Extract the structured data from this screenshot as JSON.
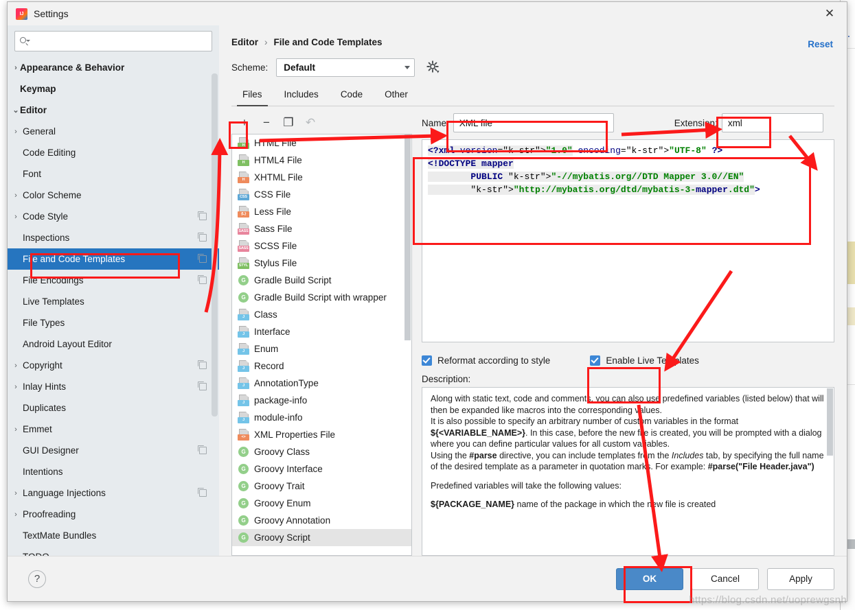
{
  "window": {
    "title": "Settings",
    "logo_icon": "intellij-idea-logo",
    "close_icon": "close-icon"
  },
  "sidebar": {
    "search": {
      "placeholder": "",
      "value": "",
      "icon": "search-icon"
    },
    "items": [
      {
        "label": "Appearance & Behavior",
        "level": 0,
        "chevron": "›",
        "bold": true,
        "badge": false
      },
      {
        "label": "Keymap",
        "level": 0,
        "chevron": "",
        "bold": true,
        "badge": false
      },
      {
        "label": "Editor",
        "level": 0,
        "chevron": "⌄",
        "bold": true,
        "badge": false
      },
      {
        "label": "General",
        "level": 1,
        "chevron": "›",
        "bold": false,
        "badge": false
      },
      {
        "label": "Code Editing",
        "level": 1,
        "chevron": "",
        "bold": false,
        "badge": false
      },
      {
        "label": "Font",
        "level": 1,
        "chevron": "",
        "bold": false,
        "badge": false
      },
      {
        "label": "Color Scheme",
        "level": 1,
        "chevron": "›",
        "bold": false,
        "badge": false
      },
      {
        "label": "Code Style",
        "level": 1,
        "chevron": "›",
        "bold": false,
        "badge": true
      },
      {
        "label": "Inspections",
        "level": 1,
        "chevron": "",
        "bold": false,
        "badge": true
      },
      {
        "label": "File and Code Templates",
        "level": 1,
        "chevron": "",
        "bold": false,
        "badge": true,
        "selected": true
      },
      {
        "label": "File Encodings",
        "level": 1,
        "chevron": "",
        "bold": false,
        "badge": true
      },
      {
        "label": "Live Templates",
        "level": 1,
        "chevron": "",
        "bold": false,
        "badge": false
      },
      {
        "label": "File Types",
        "level": 1,
        "chevron": "",
        "bold": false,
        "badge": false
      },
      {
        "label": "Android Layout Editor",
        "level": 1,
        "chevron": "",
        "bold": false,
        "badge": false
      },
      {
        "label": "Copyright",
        "level": 1,
        "chevron": "›",
        "bold": false,
        "badge": true
      },
      {
        "label": "Inlay Hints",
        "level": 1,
        "chevron": "›",
        "bold": false,
        "badge": true
      },
      {
        "label": "Duplicates",
        "level": 1,
        "chevron": "",
        "bold": false,
        "badge": false
      },
      {
        "label": "Emmet",
        "level": 1,
        "chevron": "›",
        "bold": false,
        "badge": false
      },
      {
        "label": "GUI Designer",
        "level": 1,
        "chevron": "",
        "bold": false,
        "badge": true
      },
      {
        "label": "Intentions",
        "level": 1,
        "chevron": "",
        "bold": false,
        "badge": false
      },
      {
        "label": "Language Injections",
        "level": 1,
        "chevron": "›",
        "bold": false,
        "badge": true
      },
      {
        "label": "Proofreading",
        "level": 1,
        "chevron": "›",
        "bold": false,
        "badge": false
      },
      {
        "label": "TextMate Bundles",
        "level": 1,
        "chevron": "",
        "bold": false,
        "badge": false
      },
      {
        "label": "TODO",
        "level": 1,
        "chevron": "",
        "bold": false,
        "badge": false
      }
    ]
  },
  "main": {
    "breadcrumb": {
      "parent": "Editor",
      "separator": "›",
      "current": "File and Code Templates"
    },
    "reset_label": "Reset",
    "scheme": {
      "label": "Scheme:",
      "value": "Default",
      "gear_icon": "gear-icon"
    },
    "tabs": [
      {
        "label": "Files",
        "active": true
      },
      {
        "label": "Includes",
        "active": false
      },
      {
        "label": "Code",
        "active": false
      },
      {
        "label": "Other",
        "active": false
      }
    ],
    "toolbar": [
      {
        "icon": "plus-icon",
        "glyph": "+",
        "dim": false
      },
      {
        "icon": "minus-icon",
        "glyph": "−",
        "dim": false
      },
      {
        "icon": "copy-icon",
        "glyph": "❐",
        "dim": false
      },
      {
        "icon": "undo-icon",
        "glyph": "↶",
        "dim": true
      }
    ],
    "template_list": [
      {
        "label": "HTML File",
        "icon": "html-file-icon",
        "badge": "H",
        "color": "#7fbf62",
        "shape": "page"
      },
      {
        "label": "HTML4 File",
        "icon": "html4-file-icon",
        "badge": "H",
        "color": "#7fbf62",
        "shape": "page"
      },
      {
        "label": "XHTML File",
        "icon": "xhtml-file-icon",
        "badge": "H",
        "color": "#ef8b5c",
        "shape": "page"
      },
      {
        "label": "CSS File",
        "icon": "css-file-icon",
        "badge": "CSS",
        "color": "#5fa8d6",
        "shape": "page"
      },
      {
        "label": "Less File",
        "icon": "less-file-icon",
        "badge": "{L}",
        "color": "#ef8b5c",
        "shape": "page"
      },
      {
        "label": "Sass File",
        "icon": "sass-file-icon",
        "badge": "SASS",
        "color": "#e8849c",
        "shape": "page"
      },
      {
        "label": "SCSS File",
        "icon": "scss-file-icon",
        "badge": "SASS",
        "color": "#e8849c",
        "shape": "page"
      },
      {
        "label": "Stylus File",
        "icon": "stylus-file-icon",
        "badge": "STYL",
        "color": "#7fbf62",
        "shape": "page"
      },
      {
        "label": "Gradle Build Script",
        "icon": "gradle-icon",
        "badge": "G",
        "color": "#93cf8a",
        "shape": "circle"
      },
      {
        "label": "Gradle Build Script with wrapper",
        "icon": "gradle-wrapper-icon",
        "badge": "G",
        "color": "#93cf8a",
        "shape": "circle"
      },
      {
        "label": "Class",
        "icon": "java-class-icon",
        "badge": "J",
        "color": "#74c4e8",
        "shape": "page"
      },
      {
        "label": "Interface",
        "icon": "java-interface-icon",
        "badge": "J",
        "color": "#74c4e8",
        "shape": "page"
      },
      {
        "label": "Enum",
        "icon": "java-enum-icon",
        "badge": "J",
        "color": "#74c4e8",
        "shape": "page"
      },
      {
        "label": "Record",
        "icon": "java-record-icon",
        "badge": "J",
        "color": "#74c4e8",
        "shape": "page"
      },
      {
        "label": "AnnotationType",
        "icon": "java-annotation-icon",
        "badge": "J",
        "color": "#74c4e8",
        "shape": "page"
      },
      {
        "label": "package-info",
        "icon": "package-info-icon",
        "badge": "J",
        "color": "#74c4e8",
        "shape": "page"
      },
      {
        "label": "module-info",
        "icon": "module-info-icon",
        "badge": "J",
        "color": "#74c4e8",
        "shape": "page"
      },
      {
        "label": "XML Properties File",
        "icon": "xml-properties-icon",
        "badge": "<>",
        "color": "#ef8b5c",
        "shape": "page"
      },
      {
        "label": "Groovy Class",
        "icon": "groovy-class-icon",
        "badge": "G",
        "color": "#93cf8a",
        "shape": "circle"
      },
      {
        "label": "Groovy Interface",
        "icon": "groovy-interface-icon",
        "badge": "G",
        "color": "#93cf8a",
        "shape": "circle"
      },
      {
        "label": "Groovy Trait",
        "icon": "groovy-trait-icon",
        "badge": "G",
        "color": "#93cf8a",
        "shape": "circle"
      },
      {
        "label": "Groovy Enum",
        "icon": "groovy-enum-icon",
        "badge": "G",
        "color": "#93cf8a",
        "shape": "circle"
      },
      {
        "label": "Groovy Annotation",
        "icon": "groovy-annotation-icon",
        "badge": "G",
        "color": "#93cf8a",
        "shape": "circle"
      },
      {
        "label": "Groovy Script",
        "icon": "groovy-script-icon",
        "badge": "G",
        "color": "#93cf8a",
        "shape": "circle",
        "selected": true
      }
    ],
    "detail": {
      "name_label": "Name:",
      "name_value": "XML file",
      "extension_label": "Extension:",
      "extension_value": "xml",
      "code_lines": [
        "<?xml version=\"1.0\" encoding=\"UTF-8\" ?>",
        "<!DOCTYPE mapper",
        "        PUBLIC \"-//mybatis.org//DTD Mapper 3.0//EN\"",
        "        \"http://mybatis.org/dtd/mybatis-3-mapper.dtd\">"
      ],
      "reformat_checkbox": {
        "label": "Reformat according to style",
        "checked": true
      },
      "live_templates_checkbox": {
        "label": "Enable Live Templates",
        "checked": true
      },
      "description_label": "Description:",
      "description_paragraphs": [
        "Along with static text, code and comments, you can also use predefined variables (listed below) that will then be expanded like macros into the corresponding values.",
        "It is also possible to specify an arbitrary number of custom variables in the format ${<VARIABLE_NAME>}. In this case, before the new file is created, you will be prompted with a dialog where you can define particular values for all custom variables.",
        "Using the #parse directive, you can include templates from the Includes tab, by specifying the full name of the desired template as a parameter in quotation marks. For example: #parse(\"File Header.java\")",
        "Predefined variables will take the following values:",
        "${PACKAGE_NAME}            name of the package in which the new file is created"
      ]
    }
  },
  "footer": {
    "help_icon": "help-icon",
    "help_glyph": "?",
    "buttons": [
      {
        "label": "OK",
        "style": "primary"
      },
      {
        "label": "Cancel",
        "style": "normal"
      },
      {
        "label": "Apply",
        "style": "normal"
      }
    ]
  },
  "watermark": "https://blog.csdn.net/uoprewgsnh",
  "colors": {
    "accent": "#2675bf",
    "annotation": "#fb1a1a",
    "primary_button": "#4a89c8",
    "link": "#2470c9"
  }
}
